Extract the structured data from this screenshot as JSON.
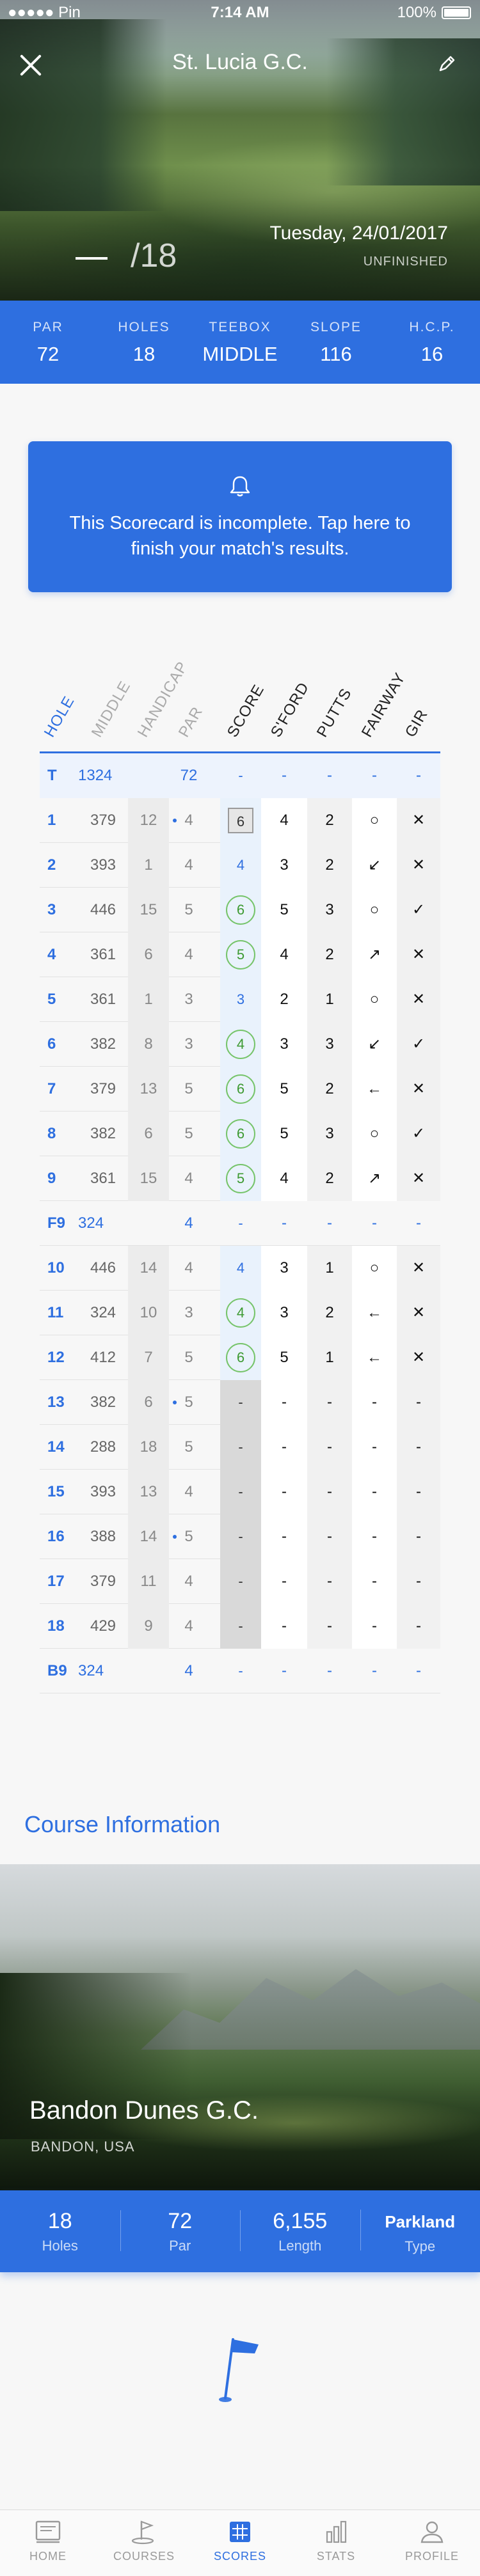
{
  "status_bar": {
    "carrier": "●●●●● Pin",
    "time": "7:14 AM",
    "battery": "100%"
  },
  "header": {
    "title": "St. Lucia G.C.",
    "hole_total": "/18",
    "date": "Tuesday, 24/01/2017",
    "status": "UNFINISHED"
  },
  "stats": [
    {
      "label": "PAR",
      "value": "72"
    },
    {
      "label": "HOLES",
      "value": "18"
    },
    {
      "label": "TEEBOX",
      "value": "MIDDLE"
    },
    {
      "label": "SLOPE",
      "value": "116"
    },
    {
      "label": "H.C.P.",
      "value": "16"
    }
  ],
  "alert": {
    "message": "This Scorecard is incomplete. Tap here to finish your match's results."
  },
  "scorecard": {
    "headers": [
      "HOLE",
      "MIDDLE",
      "HANDICAP",
      "PAR",
      "SCORE",
      "S'FORD",
      "PUTTS",
      "FAIRWAY",
      "GIR"
    ],
    "total_row": {
      "hole": "T",
      "middle": "1324",
      "par": "72",
      "score": "-",
      "sford": "-",
      "putts": "-",
      "fairway": "-",
      "gir": "-"
    },
    "front_rows": [
      {
        "hole": "1",
        "middle": "379",
        "hcp": "12",
        "dot": true,
        "par": "4",
        "score": "6",
        "style": "boxed",
        "sford": "4",
        "putts": "2",
        "fairway": "○",
        "gir": "✕"
      },
      {
        "hole": "2",
        "middle": "393",
        "hcp": "1",
        "dot": false,
        "par": "4",
        "score": "4",
        "style": "plain",
        "sford": "3",
        "putts": "2",
        "fairway": "↙",
        "gir": "✕"
      },
      {
        "hole": "3",
        "middle": "446",
        "hcp": "15",
        "dot": false,
        "par": "5",
        "score": "6",
        "style": "circled",
        "sford": "5",
        "putts": "3",
        "fairway": "○",
        "gir": "✓"
      },
      {
        "hole": "4",
        "middle": "361",
        "hcp": "6",
        "dot": false,
        "par": "4",
        "score": "5",
        "style": "circled",
        "sford": "4",
        "putts": "2",
        "fairway": "↗",
        "gir": "✕"
      },
      {
        "hole": "5",
        "middle": "361",
        "hcp": "1",
        "dot": false,
        "par": "3",
        "score": "3",
        "style": "plain",
        "sford": "2",
        "putts": "1",
        "fairway": "○",
        "gir": "✕"
      },
      {
        "hole": "6",
        "middle": "382",
        "hcp": "8",
        "dot": false,
        "par": "3",
        "score": "4",
        "style": "circled",
        "sford": "3",
        "putts": "3",
        "fairway": "↙",
        "gir": "✓"
      },
      {
        "hole": "7",
        "middle": "379",
        "hcp": "13",
        "dot": false,
        "par": "5",
        "score": "6",
        "style": "circled",
        "sford": "5",
        "putts": "2",
        "fairway": "←",
        "gir": "✕"
      },
      {
        "hole": "8",
        "middle": "382",
        "hcp": "6",
        "dot": false,
        "par": "5",
        "score": "6",
        "style": "circled",
        "sford": "5",
        "putts": "3",
        "fairway": "○",
        "gir": "✓"
      },
      {
        "hole": "9",
        "middle": "361",
        "hcp": "15",
        "dot": false,
        "par": "4",
        "score": "5",
        "style": "circled",
        "sford": "4",
        "putts": "2",
        "fairway": "↗",
        "gir": "✕"
      }
    ],
    "front_summary": {
      "hole": "F9",
      "middle": "324",
      "par": "4",
      "score": "-",
      "sford": "-",
      "putts": "-",
      "fairway": "-",
      "gir": "-"
    },
    "back_rows": [
      {
        "hole": "10",
        "middle": "446",
        "hcp": "14",
        "dot": false,
        "par": "4",
        "score": "4",
        "style": "plain",
        "sford": "3",
        "putts": "1",
        "fairway": "○",
        "gir": "✕"
      },
      {
        "hole": "11",
        "middle": "324",
        "hcp": "10",
        "dot": false,
        "par": "3",
        "score": "4",
        "style": "circled",
        "sford": "3",
        "putts": "2",
        "fairway": "←",
        "gir": "✕"
      },
      {
        "hole": "12",
        "middle": "412",
        "hcp": "7",
        "dot": false,
        "par": "5",
        "score": "6",
        "style": "circled",
        "sford": "5",
        "putts": "1",
        "fairway": "←",
        "gir": "✕"
      },
      {
        "hole": "13",
        "middle": "382",
        "hcp": "6",
        "dot": true,
        "par": "5",
        "score": "-",
        "style": "dash",
        "sford": "-",
        "putts": "-",
        "fairway": "-",
        "gir": "-"
      },
      {
        "hole": "14",
        "middle": "288",
        "hcp": "18",
        "dot": false,
        "par": "5",
        "score": "-",
        "style": "dash",
        "sford": "-",
        "putts": "-",
        "fairway": "-",
        "gir": "-"
      },
      {
        "hole": "15",
        "middle": "393",
        "hcp": "13",
        "dot": false,
        "par": "4",
        "score": "-",
        "style": "dash",
        "sford": "-",
        "putts": "-",
        "fairway": "-",
        "gir": "-"
      },
      {
        "hole": "16",
        "middle": "388",
        "hcp": "14",
        "dot": true,
        "par": "5",
        "score": "-",
        "style": "dash",
        "sford": "-",
        "putts": "-",
        "fairway": "-",
        "gir": "-"
      },
      {
        "hole": "17",
        "middle": "379",
        "hcp": "11",
        "dot": false,
        "par": "4",
        "score": "-",
        "style": "dash",
        "sford": "-",
        "putts": "-",
        "fairway": "-",
        "gir": "-"
      },
      {
        "hole": "18",
        "middle": "429",
        "hcp": "9",
        "dot": false,
        "par": "4",
        "score": "-",
        "style": "dash",
        "sford": "-",
        "putts": "-",
        "fairway": "-",
        "gir": "-"
      }
    ],
    "back_summary": {
      "hole": "B9",
      "middle": "324",
      "par": "4",
      "score": "-",
      "sford": "-",
      "putts": "-",
      "fairway": "-",
      "gir": "-"
    }
  },
  "course_info": {
    "section_title": "Course Information",
    "name": "Bandon Dunes G.C.",
    "location": "BANDON, USA",
    "stats": [
      {
        "value": "18",
        "label": "Holes"
      },
      {
        "value": "72",
        "label": "Par"
      },
      {
        "value": "6,155",
        "label": "Length"
      },
      {
        "value": "Parkland",
        "label": "Type"
      }
    ]
  },
  "tabs": [
    {
      "label": "HOME",
      "icon": "home-icon"
    },
    {
      "label": "COURSES",
      "icon": "courses-icon"
    },
    {
      "label": "SCORES",
      "icon": "scores-icon",
      "active": true
    },
    {
      "label": "STATS",
      "icon": "stats-icon"
    },
    {
      "label": "PROFILE",
      "icon": "profile-icon"
    }
  ],
  "colors": {
    "accent": "#2e6fe0",
    "good": "#76c46a"
  }
}
